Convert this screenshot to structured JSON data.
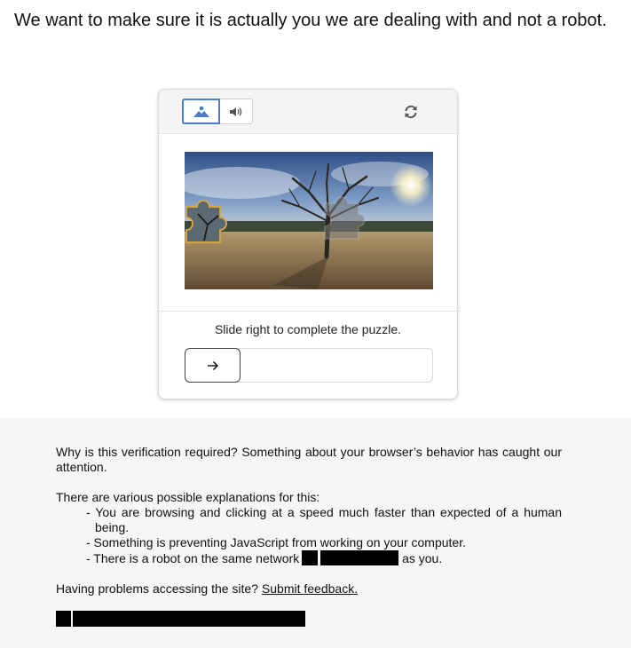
{
  "headline": "We want to make sure it is actually you we are dealing with and not a robot.",
  "captcha": {
    "modes": [
      {
        "icon": "image-icon",
        "active": true
      },
      {
        "icon": "speaker-icon",
        "active": false
      }
    ],
    "refresh_icon": "refresh-icon",
    "instruction": "Slide right to complete the puzzle.",
    "slider_icon": "arrow-right-icon",
    "accent_color": "#4a7ec9"
  },
  "info": {
    "why": "Why is this verification required? Something about your browser’s behavior has caught our attention.",
    "explanations_intro": "There are various possible explanations for this:",
    "explanations": [
      "- You are browsing and clicking at a speed much faster than expected of a human being.",
      "- Something is preventing JavaScript from working on your computer.",
      "- There is a robot on the same network"
    ],
    "network_suffix": "as you.",
    "problems_prefix": "Having problems accessing the site?",
    "feedback_link": "Submit feedback."
  }
}
